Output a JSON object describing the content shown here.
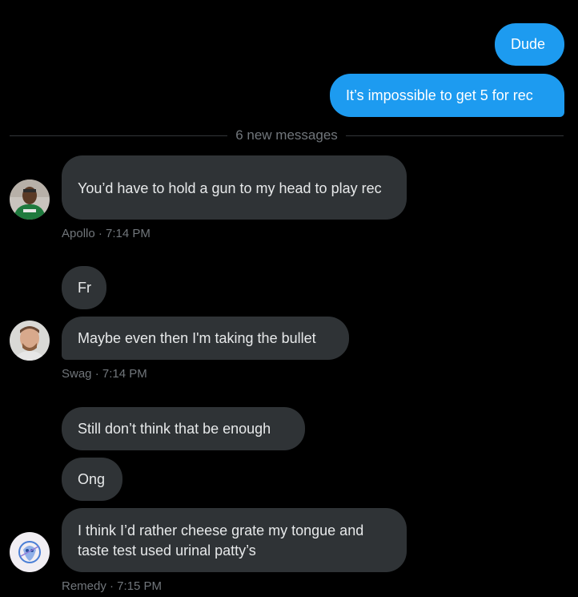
{
  "sent_messages": [
    {
      "text": "Dude"
    },
    {
      "text": "It’s impossible to get 5 for rec"
    }
  ],
  "divider": {
    "label": "6 new messages"
  },
  "groups": [
    {
      "sender": "Apollo",
      "avatar_icon": "person-green-jersey-avatar",
      "messages": [
        "You’d have to hold a gun to my head to play rec"
      ],
      "meta": "Apollo · 7:14 PM"
    },
    {
      "sender": "Swag",
      "avatar_icon": "person-portrait-avatar",
      "messages": [
        "Fr",
        "Maybe even then I'm taking the bullet"
      ],
      "meta": "Swag · 7:14 PM"
    },
    {
      "sender": "Remedy",
      "avatar_icon": "blue-sketch-avatar",
      "messages": [
        "Still don’t think that be enough",
        "Ong",
        "I think I’d rather cheese grate my tongue and taste test used urinal patty’s"
      ],
      "meta": "Remedy · 7:15 PM"
    }
  ],
  "colors": {
    "background": "#000000",
    "sent_bubble": "#1d9bf0",
    "received_bubble": "#2f3336",
    "meta_text": "#71767b"
  }
}
